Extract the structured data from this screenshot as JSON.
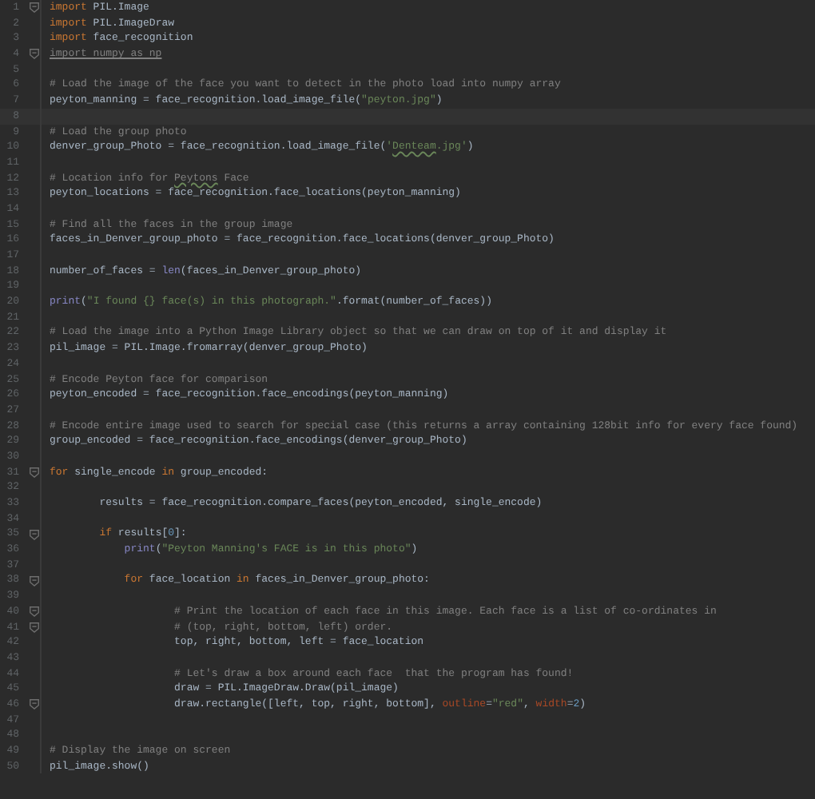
{
  "editor": {
    "lines": [
      {
        "number": "1",
        "fold": true,
        "tokens": [
          {
            "kind": "keyword",
            "text": "import"
          },
          {
            "kind": "plain",
            "text": " PIL.Image"
          }
        ]
      },
      {
        "number": "2",
        "tokens": [
          {
            "kind": "keyword",
            "text": "import"
          },
          {
            "kind": "plain",
            "text": " PIL.ImageDraw"
          }
        ]
      },
      {
        "number": "3",
        "tokens": [
          {
            "kind": "keyword",
            "text": "import"
          },
          {
            "kind": "plain",
            "text": " face_recognition"
          }
        ]
      },
      {
        "number": "4",
        "fold": true,
        "tokens": [
          {
            "kind": "unused",
            "text": "import numpy as np"
          }
        ]
      },
      {
        "number": "5"
      },
      {
        "number": "6",
        "tokens": [
          {
            "kind": "comment",
            "text": "# Load the image of the face you want to detect in the photo load into numpy array"
          }
        ]
      },
      {
        "number": "7",
        "tokens": [
          {
            "kind": "plain",
            "text": "peyton_manning = face_recognition.load_image_file("
          },
          {
            "kind": "string",
            "text": "\"peyton.jpg\""
          },
          {
            "kind": "plain",
            "text": ")"
          }
        ]
      },
      {
        "number": "8",
        "current": true
      },
      {
        "number": "9",
        "tokens": [
          {
            "kind": "comment",
            "text": "# Load the group photo"
          }
        ]
      },
      {
        "number": "10",
        "tokens": [
          {
            "kind": "plain",
            "text": "denver_group_Photo = face_recognition.load_image_file("
          },
          {
            "kind": "string",
            "text": "'"
          },
          {
            "kind": "string-typo",
            "text": "Denteam"
          },
          {
            "kind": "string",
            "text": ".jpg'"
          },
          {
            "kind": "plain",
            "text": ")"
          }
        ]
      },
      {
        "number": "11"
      },
      {
        "number": "12",
        "tokens": [
          {
            "kind": "comment",
            "text": "# Location info for "
          },
          {
            "kind": "comment-typo",
            "text": "Peytons"
          },
          {
            "kind": "comment",
            "text": " Face"
          }
        ]
      },
      {
        "number": "13",
        "tokens": [
          {
            "kind": "plain",
            "text": "peyton_locations = face_recognition.face_locations(peyton_manning)"
          }
        ]
      },
      {
        "number": "14"
      },
      {
        "number": "15",
        "tokens": [
          {
            "kind": "comment",
            "text": "# Find all the faces in the group image"
          }
        ]
      },
      {
        "number": "16",
        "tokens": [
          {
            "kind": "plain",
            "text": "faces_in_Denver_group_photo = face_recognition.face_locations(denver_group_Photo)"
          }
        ]
      },
      {
        "number": "17"
      },
      {
        "number": "18",
        "tokens": [
          {
            "kind": "plain",
            "text": "number_of_faces = "
          },
          {
            "kind": "builtin",
            "text": "len"
          },
          {
            "kind": "plain",
            "text": "(faces_in_Denver_group_photo)"
          }
        ]
      },
      {
        "number": "19"
      },
      {
        "number": "20",
        "tokens": [
          {
            "kind": "builtin",
            "text": "print"
          },
          {
            "kind": "plain",
            "text": "("
          },
          {
            "kind": "string",
            "text": "\"I found {} face(s) in this photograph.\""
          },
          {
            "kind": "plain",
            "text": ".format(number_of_faces))"
          }
        ]
      },
      {
        "number": "21"
      },
      {
        "number": "22",
        "tokens": [
          {
            "kind": "comment",
            "text": "# Load the image into a Python Image Library object so that we can draw on top of it and display it"
          }
        ]
      },
      {
        "number": "23",
        "tokens": [
          {
            "kind": "plain",
            "text": "pil_image = PIL.Image.fromarray(denver_group_Photo)"
          }
        ]
      },
      {
        "number": "24"
      },
      {
        "number": "25",
        "tokens": [
          {
            "kind": "comment",
            "text": "# Encode Peyton face for comparison"
          }
        ]
      },
      {
        "number": "26",
        "tokens": [
          {
            "kind": "plain",
            "text": "peyton_encoded = face_recognition.face_encodings(peyton_manning)"
          }
        ]
      },
      {
        "number": "27"
      },
      {
        "number": "28",
        "tokens": [
          {
            "kind": "comment",
            "text": "# Encode entire image used to search for special case (this returns a array containing 128bit info for every face found)"
          }
        ]
      },
      {
        "number": "29",
        "tokens": [
          {
            "kind": "plain",
            "text": "group_encoded = face_recognition.face_encodings(denver_group_Photo)"
          }
        ]
      },
      {
        "number": "30"
      },
      {
        "number": "31",
        "fold": true,
        "tokens": [
          {
            "kind": "keyword",
            "text": "for"
          },
          {
            "kind": "plain",
            "text": " single_encode "
          },
          {
            "kind": "keyword",
            "text": "in"
          },
          {
            "kind": "plain",
            "text": " group_encoded:"
          }
        ]
      },
      {
        "number": "32"
      },
      {
        "number": "33",
        "tokens": [
          {
            "kind": "plain",
            "text": "        results = face_recognition.compare_faces(peyton_encoded, single_encode)"
          }
        ]
      },
      {
        "number": "34"
      },
      {
        "number": "35",
        "fold": true,
        "tokens": [
          {
            "kind": "keyword",
            "text": "        if"
          },
          {
            "kind": "plain",
            "text": " results["
          },
          {
            "kind": "number",
            "text": "0"
          },
          {
            "kind": "plain",
            "text": "]:"
          }
        ]
      },
      {
        "number": "36",
        "tokens": [
          {
            "kind": "builtin",
            "text": "            print"
          },
          {
            "kind": "plain",
            "text": "("
          },
          {
            "kind": "string",
            "text": "\"Peyton Manning's FACE is in this photo\""
          },
          {
            "kind": "plain",
            "text": ")"
          }
        ]
      },
      {
        "number": "37"
      },
      {
        "number": "38",
        "fold": true,
        "tokens": [
          {
            "kind": "keyword",
            "text": "            for"
          },
          {
            "kind": "plain",
            "text": " face_location "
          },
          {
            "kind": "keyword",
            "text": "in"
          },
          {
            "kind": "plain",
            "text": " faces_in_Denver_group_photo:"
          }
        ]
      },
      {
        "number": "39"
      },
      {
        "number": "40",
        "fold": true,
        "tokens": [
          {
            "kind": "comment",
            "text": "                    # Print the location of each face in this image. Each face is a list of co-ordinates in"
          }
        ]
      },
      {
        "number": "41",
        "fold": true,
        "tokens": [
          {
            "kind": "comment",
            "text": "                    # (top, right, bottom, left) order."
          }
        ]
      },
      {
        "number": "42",
        "tokens": [
          {
            "kind": "plain",
            "text": "                    top, right, bottom, left = face_location"
          }
        ]
      },
      {
        "number": "43"
      },
      {
        "number": "44",
        "tokens": [
          {
            "kind": "comment",
            "text": "                    # Let's draw a box around each face  that the program has found!"
          }
        ]
      },
      {
        "number": "45",
        "tokens": [
          {
            "kind": "plain",
            "text": "                    draw = PIL.ImageDraw.Draw(pil_image)"
          }
        ]
      },
      {
        "number": "46",
        "fold": true,
        "tokens": [
          {
            "kind": "plain",
            "text": "                    draw.rectangle([left, top, right, bottom], "
          },
          {
            "kind": "param",
            "text": "outline"
          },
          {
            "kind": "plain",
            "text": "="
          },
          {
            "kind": "string",
            "text": "\"red\""
          },
          {
            "kind": "plain",
            "text": ", "
          },
          {
            "kind": "param",
            "text": "width"
          },
          {
            "kind": "plain",
            "text": "="
          },
          {
            "kind": "number",
            "text": "2"
          },
          {
            "kind": "plain",
            "text": ")"
          }
        ]
      },
      {
        "number": "47"
      },
      {
        "number": "48"
      },
      {
        "number": "49",
        "tokens": [
          {
            "kind": "comment",
            "text": "# Display the image on screen"
          }
        ]
      },
      {
        "number": "50",
        "tokens": [
          {
            "kind": "plain",
            "text": "pil_image.show()"
          }
        ]
      }
    ]
  }
}
